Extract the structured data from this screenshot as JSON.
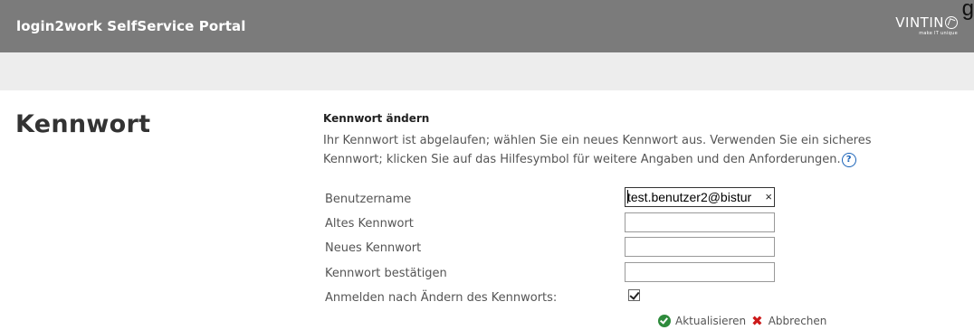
{
  "header": {
    "app_title": "login2work SelfService Portal",
    "logo_text": "VINTIN",
    "logo_tagline": "make IT unique",
    "overflow_text": "g"
  },
  "page": {
    "heading": "Kennwort"
  },
  "form": {
    "section_title": "Kennwort ändern",
    "description": "Ihr Kennwort ist abgelaufen; wählen Sie ein neues Kennwort aus. Verwenden Sie ein sicheres Kennwort; klicken Sie auf das Hilfesymbol für weitere Angaben und den Anforderungen.",
    "help_glyph": "?",
    "fields": {
      "username": {
        "label": "Benutzername",
        "value": "test.benutzer2@bistur"
      },
      "old_password": {
        "label": "Altes Kennwort",
        "value": ""
      },
      "new_password": {
        "label": "Neues Kennwort",
        "value": ""
      },
      "confirm_password": {
        "label": "Kennwort bestätigen",
        "value": ""
      }
    },
    "signin_after_change": {
      "label": "Anmelden nach Ändern des Kennworts:",
      "checked": true
    },
    "clear_glyph": "×",
    "actions": {
      "update_label": "Aktualisieren",
      "cancel_label": "Abbrechen",
      "cancel_glyph": "✖"
    }
  },
  "icons": {
    "help": "help-icon",
    "confirm": "check-circle-icon",
    "cancel": "cross-icon",
    "clear": "close-icon"
  },
  "colors": {
    "header_bg": "#7b7b7b",
    "subbar_bg": "#ededed",
    "confirm": "#2e8b3c",
    "cancel": "#cc1a1a",
    "help": "#1a63b8"
  }
}
